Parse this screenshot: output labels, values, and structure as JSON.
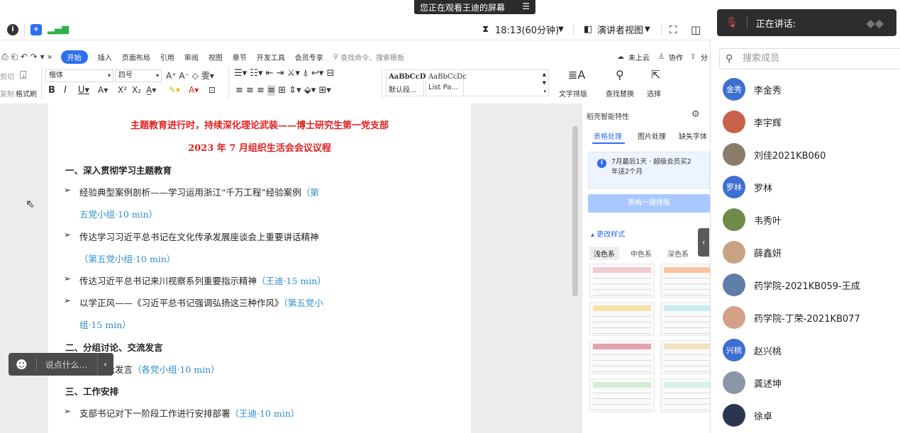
{
  "share_banner": {
    "text": "您正在观看王迪的屏幕"
  },
  "meeting_bar": {
    "timer": "18:13(60分钟)",
    "view_mode": "演讲者视图"
  },
  "speaking": {
    "label": "正在讲话:"
  },
  "ribbon": {
    "tabs": [
      "开始",
      "插入",
      "页面布局",
      "引用",
      "审阅",
      "视图",
      "章节",
      "开发工具",
      "会员专享"
    ],
    "search_placeholder": "查找命令、搜索模板",
    "right": {
      "cloud": "未上云",
      "collab": "协作",
      "share": "分"
    },
    "font_name": "楷体",
    "font_size": "四号",
    "format_painter": "格式刷",
    "styles": [
      {
        "sample": "AaBbCcDd",
        "name": "默认段..."
      },
      {
        "sample": "AaBbCcDc",
        "name": "List Pa..."
      }
    ],
    "text_layout": "文字排版",
    "find_replace": "查找替换",
    "select": "选择",
    "left_clip": {
      "cut": "剪切",
      "copy": "复制"
    }
  },
  "document": {
    "title1": "主题教育进行时，持续深化理论武装——博士研究生第一党支部",
    "title2": "2023 年 7 月组织生活会会议议程",
    "lines": [
      {
        "type": "heading",
        "text": "一、深入贯彻学习主题教育"
      },
      {
        "type": "item",
        "text": "经验典型案例剖析——学习运用浙江“千万工程”经验案例",
        "note": "（第"
      },
      {
        "type": "cont",
        "text": "",
        "note": "五党小组·10 min）"
      },
      {
        "type": "item",
        "text": "传达学习习近平总书记在文化传承发展座谈会上重要讲话精神",
        "note": ""
      },
      {
        "type": "cont",
        "text": "",
        "note": "（第五党小组·10 min）"
      },
      {
        "type": "item",
        "text": "传达习近平总书记来川视察系列重要指示精神",
        "note": "（王迪·15 min）"
      },
      {
        "type": "item",
        "text": "以学正风——《习近平总书记强调弘扬这三种作风》",
        "note": "（第五党小"
      },
      {
        "type": "cont",
        "text": "",
        "note": "组·15 min）"
      },
      {
        "type": "heading",
        "text": "二、分组讨论、交流发言"
      },
      {
        "type": "item",
        "text": "学习讨论发言",
        "note": "（各党小组·10 min）"
      },
      {
        "type": "heading",
        "text": "三、工作安排"
      },
      {
        "type": "item",
        "text": "支部书记对下一阶段工作进行安排部署",
        "note": "（王迪·10 min）"
      }
    ]
  },
  "side_panel": {
    "title": "稻壳智能特性",
    "tabs": [
      "表格处理",
      "图片处理",
      "缺失字体"
    ],
    "vip_line1": "7月最后1天 · 超级会员买2",
    "vip_line2": "年送2个月",
    "format_button": "表格一键排版",
    "change_style": "更改样式",
    "color_tabs": [
      "浅色系",
      "中色系",
      "深色系"
    ],
    "card_colors": [
      "#f1c9cf",
      "#f7c59f",
      "#f7e1a6",
      "#c9ecec",
      "#e2a3ad",
      "#f3e2c0",
      "#d4ecd8",
      "#d9f1ec"
    ]
  },
  "chat": {
    "placeholder": "说点什么..."
  },
  "members": {
    "search_placeholder": "搜索成员",
    "list": [
      {
        "name": "李金秀",
        "avatar_text": "金秀",
        "color": "#3d6fd1"
      },
      {
        "name": "李宇辉",
        "avatar_text": "",
        "color": "#c9624a"
      },
      {
        "name": "刘佳2021KB060",
        "avatar_text": "",
        "color": "#8a7b6b"
      },
      {
        "name": "罗林",
        "avatar_text": "罗林",
        "color": "#3d6fd1"
      },
      {
        "name": "韦秀叶",
        "avatar_text": "",
        "color": "#6f8a4a"
      },
      {
        "name": "薛鑫妍",
        "avatar_text": "",
        "color": "#c7a383"
      },
      {
        "name": "药学院-2021KB059-王成",
        "avatar_text": "",
        "color": "#5e7fa8"
      },
      {
        "name": "药学院-丁荣-2021KB077",
        "avatar_text": "",
        "color": "#d3a088"
      },
      {
        "name": "赵兴桃",
        "avatar_text": "兴桃",
        "color": "#3d6fd1"
      },
      {
        "name": "龚述坤",
        "avatar_text": "",
        "color": "#8b96a8"
      },
      {
        "name": "徐卓",
        "avatar_text": "",
        "color": "#2a3550"
      }
    ]
  }
}
